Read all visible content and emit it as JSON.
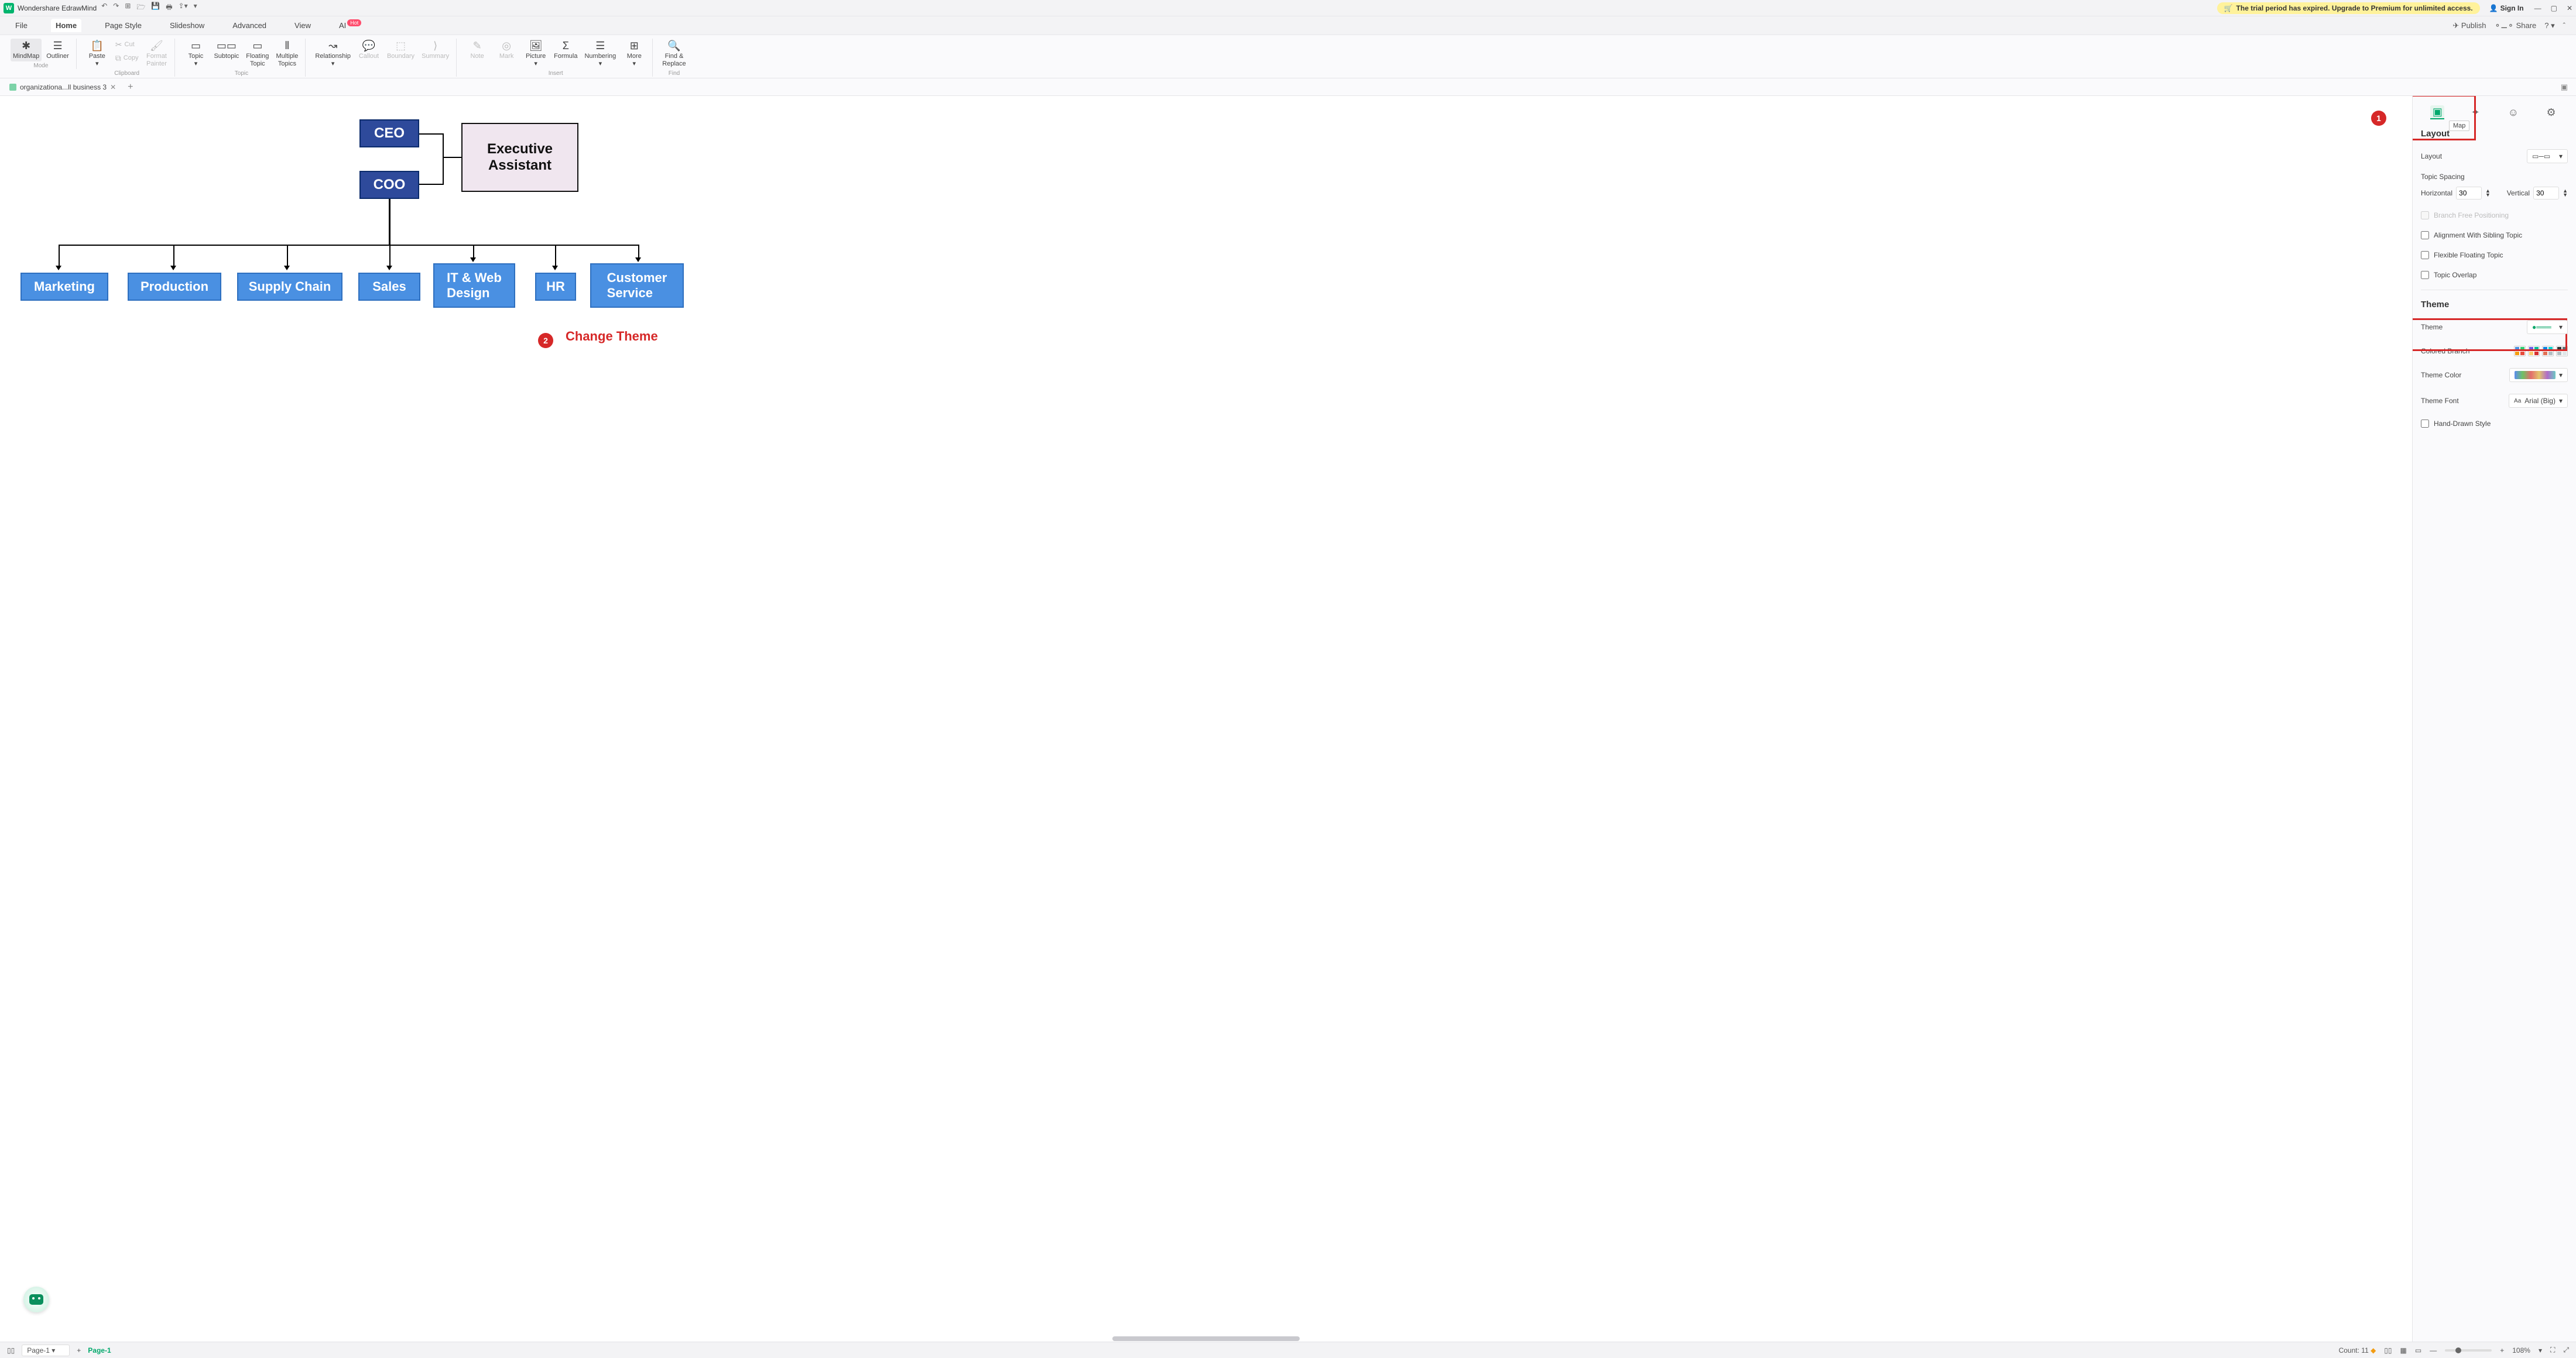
{
  "titlebar": {
    "app_name": "Wondershare EdrawMind",
    "logo_letter": "W",
    "trial_text": "The trial period has expired. Upgrade to Premium for unlimited access.",
    "signin": "Sign In"
  },
  "menu": {
    "file": "File",
    "home": "Home",
    "page_style": "Page Style",
    "slideshow": "Slideshow",
    "advanced": "Advanced",
    "view": "View",
    "ai": "AI",
    "ai_badge": "Hot",
    "publish": "Publish",
    "share": "Share"
  },
  "ribbon": {
    "mindmap": "MindMap",
    "outliner": "Outliner",
    "mode": "Mode",
    "paste": "Paste",
    "cut": "Cut",
    "copy": "Copy",
    "format_painter": "Format\nPainter",
    "clipboard": "Clipboard",
    "topic": "Topic",
    "subtopic": "Subtopic",
    "floating_topic": "Floating\nTopic",
    "multiple_topics": "Multiple\nTopics",
    "topic_group": "Topic",
    "relationship": "Relationship",
    "callout": "Callout",
    "boundary": "Boundary",
    "summary": "Summary",
    "note": "Note",
    "mark": "Mark",
    "picture": "Picture",
    "formula": "Formula",
    "numbering": "Numbering",
    "more": "More",
    "insert": "Insert",
    "find_replace": "Find &\nReplace",
    "find": "Find"
  },
  "doc": {
    "tab_name": "organizationa...ll business 3"
  },
  "chart": {
    "ceo": "CEO",
    "coo": "COO",
    "exec1": "Executive",
    "exec2": "Assistant",
    "dept": [
      "Marketing",
      "Production",
      "Supply Chain",
      "Sales",
      "IT & Web\nDesign",
      "HR",
      "Customer\nService"
    ]
  },
  "annotations": {
    "b1": "1",
    "b2": "2",
    "change_theme": "Change Theme",
    "map_tooltip": "Map"
  },
  "side": {
    "layout_title": "Layout",
    "layout_label": "Layout",
    "topic_spacing": "Topic Spacing",
    "horizontal": "Horizontal",
    "horizontal_val": "30",
    "vertical": "Vertical",
    "vertical_val": "30",
    "branch_free": "Branch Free Positioning",
    "align_sibling": "Alignment With Sibling Topic",
    "flex_float": "Flexible Floating Topic",
    "overlap": "Topic Overlap",
    "theme_title": "Theme",
    "theme_label": "Theme",
    "colored_branch": "Colored Branch",
    "theme_color": "Theme Color",
    "theme_font": "Theme Font",
    "theme_font_val": "Arial (Big)",
    "hand_drawn": "Hand-Drawn Style"
  },
  "status": {
    "page_sel": "Page-1",
    "page_current": "Page-1",
    "count_label": "Count: 11",
    "zoom": "108%"
  }
}
